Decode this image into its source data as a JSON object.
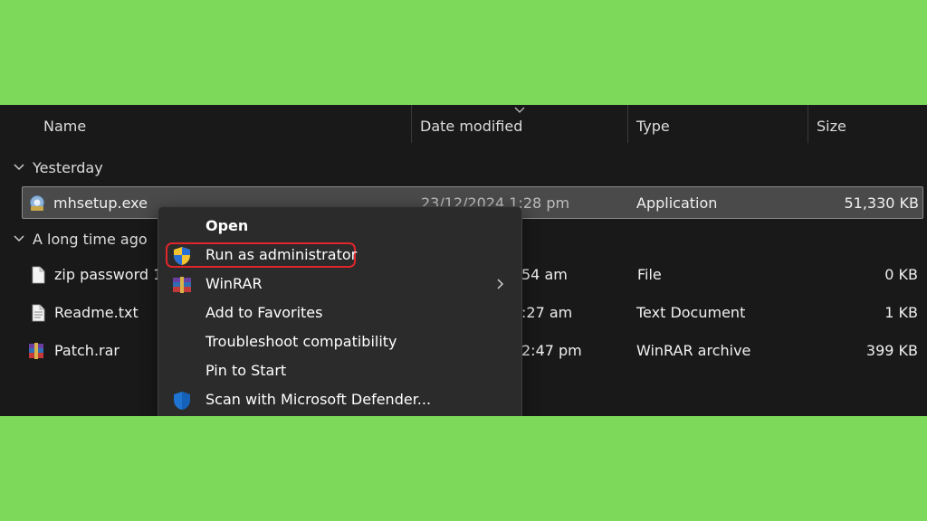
{
  "columns": {
    "name": "Name",
    "date_modified": "Date modified",
    "type": "Type",
    "size": "Size"
  },
  "groups": {
    "yesterday": "Yesterday",
    "long_time_ago": "A long time ago"
  },
  "files": [
    {
      "name": "mhsetup.exe",
      "date": "23/12/2024 1:28 pm",
      "type": "Application",
      "size": "51,330 KB",
      "icon": "installer-icon",
      "selected": true
    },
    {
      "name": "zip password 1",
      "date": "54 am",
      "type": "File",
      "size": "0 KB",
      "icon": "blank-file-icon"
    },
    {
      "name": "Readme.txt",
      "date": ":27 am",
      "type": "Text Document",
      "size": "1 KB",
      "icon": "text-file-icon"
    },
    {
      "name": "Patch.rar",
      "date": "2:47 pm",
      "type": "WinRAR archive",
      "size": "399 KB",
      "icon": "winrar-archive-icon"
    }
  ],
  "context_menu": {
    "items": [
      {
        "label": "Open",
        "bold": true
      },
      {
        "label": "Run as administrator",
        "icon": "uac-shield-icon",
        "highlighted": true
      },
      {
        "label": "WinRAR",
        "icon": "winrar-icon",
        "submenu": true
      },
      {
        "label": "Add to Favorites"
      },
      {
        "label": "Troubleshoot compatibility"
      },
      {
        "label": "Pin to Start"
      },
      {
        "label": "Scan with Microsoft Defender...",
        "icon": "defender-shield-icon"
      }
    ]
  },
  "colors": {
    "background_green": "#7cd95a",
    "explorer_bg": "#191919",
    "menu_bg": "#2b2b2b",
    "selection_bg": "#4a4a4a",
    "highlight_red": "#e0262b"
  }
}
